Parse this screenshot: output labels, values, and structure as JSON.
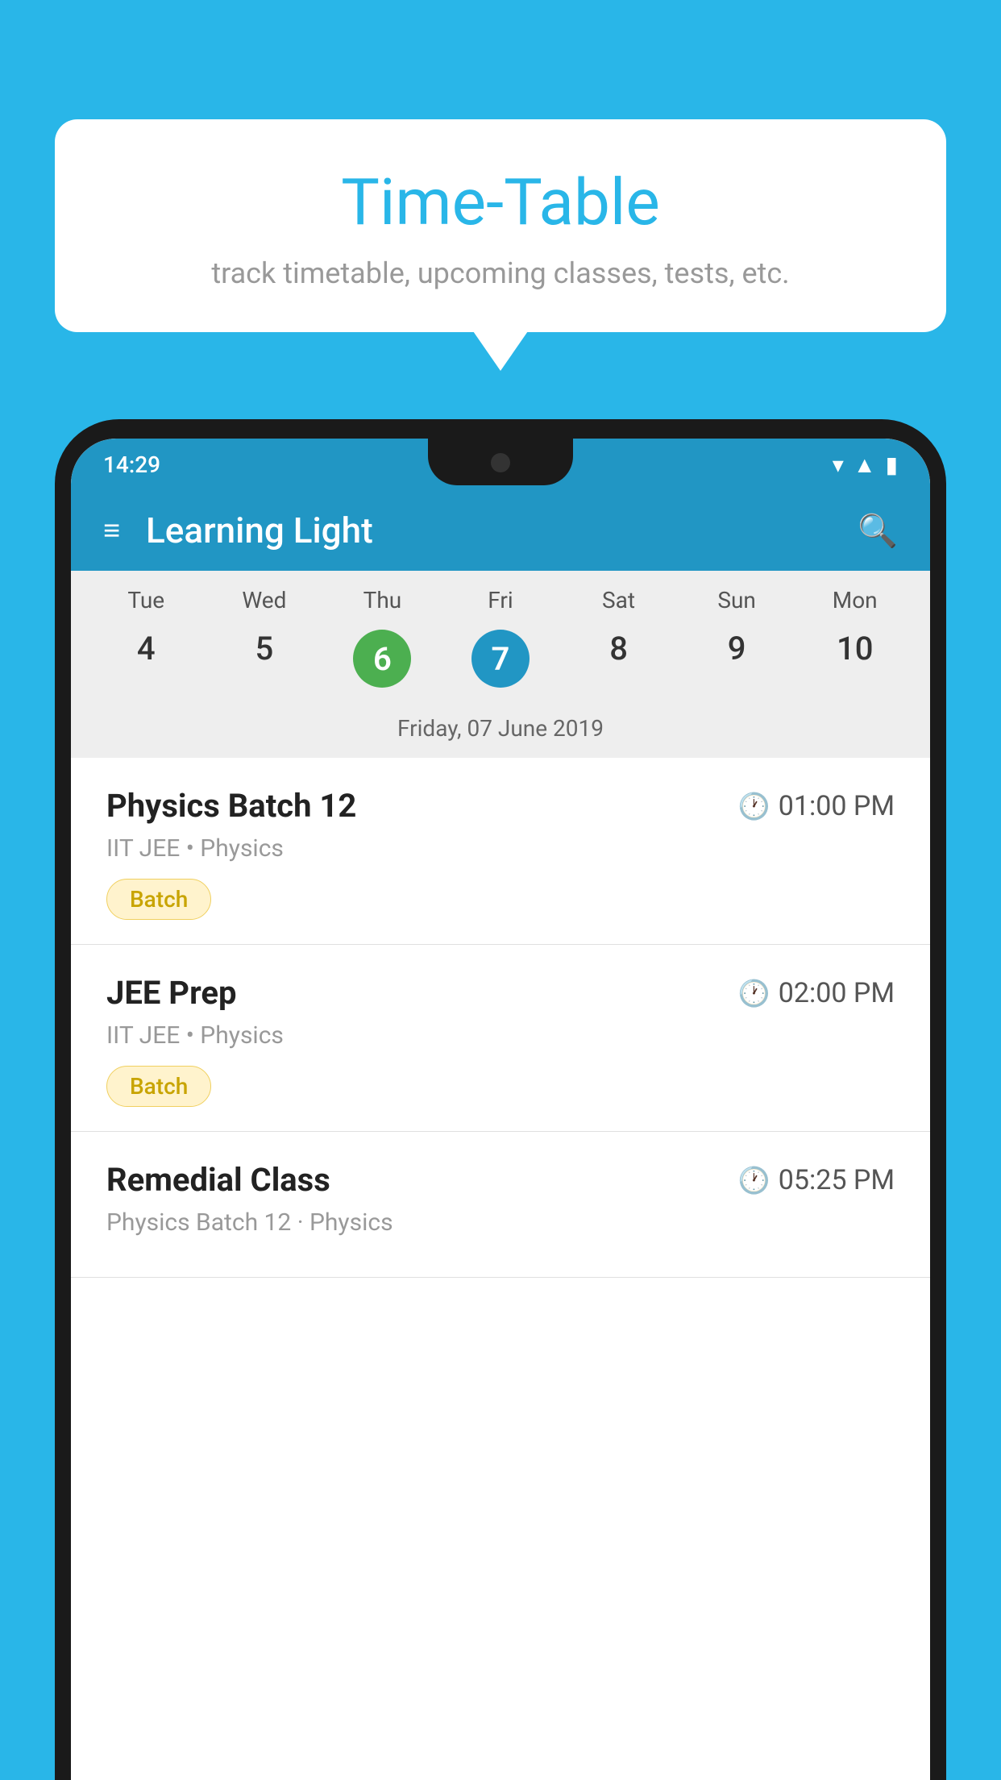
{
  "background": {
    "color": "#29B6E8"
  },
  "speech_bubble": {
    "title": "Time-Table",
    "subtitle": "track timetable, upcoming classes, tests, etc."
  },
  "phone": {
    "status_bar": {
      "time": "14:29"
    },
    "app_bar": {
      "title": "Learning Light"
    },
    "calendar": {
      "days": [
        {
          "label": "Tue",
          "number": "4"
        },
        {
          "label": "Wed",
          "number": "5"
        },
        {
          "label": "Thu",
          "number": "6",
          "style": "green"
        },
        {
          "label": "Fri",
          "number": "7",
          "style": "blue"
        },
        {
          "label": "Sat",
          "number": "8"
        },
        {
          "label": "Sun",
          "number": "9"
        },
        {
          "label": "Mon",
          "number": "10"
        }
      ],
      "selected_date": "Friday, 07 June 2019"
    },
    "classes": [
      {
        "name": "Physics Batch 12",
        "time": "01:00 PM",
        "details": "IIT JEE • Physics",
        "badge": "Batch"
      },
      {
        "name": "JEE Prep",
        "time": "02:00 PM",
        "details": "IIT JEE • Physics",
        "badge": "Batch"
      },
      {
        "name": "Remedial Class",
        "time": "05:25 PM",
        "details": "Physics Batch 12 · Physics",
        "badge": null
      }
    ]
  }
}
